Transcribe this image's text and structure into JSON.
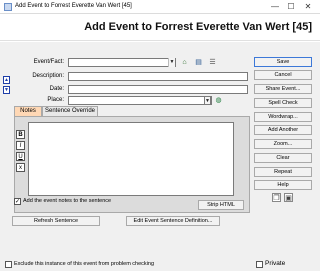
{
  "window": {
    "title": "Add Event to Forrest Everette Van Wert [45]",
    "heading": "Add Event to Forrest Everette Van Wert [45]",
    "minimize_glyph": "—",
    "maximize_glyph": "☐",
    "close_glyph": "✕"
  },
  "form": {
    "event_label": "Event/Fact:",
    "description_label": "Description:",
    "date_label": "Date:",
    "place_label": "Place:",
    "event_value": "",
    "description_value": "",
    "date_value": "",
    "place_value": ""
  },
  "tabs": [
    {
      "label": "Notes"
    },
    {
      "label": "Sentence Override"
    }
  ],
  "formatting": {
    "bold": "B",
    "italic": "I",
    "underline": "U",
    "remove": "x"
  },
  "notes": {
    "text": "",
    "add_to_sentence_label": "Add the event notes to the sentence",
    "add_to_sentence_checked": true,
    "strip_html_label": "Strip HTML"
  },
  "actions": {
    "refresh_sentence": "Refresh Sentence",
    "edit_sentence_definition": "Edit Event Sentence Definition..."
  },
  "side_buttons": {
    "save": "Save",
    "cancel": "Cancel",
    "share_event": "Share Event...",
    "spell_check": "Spell Check",
    "wordwrap": "Wordwrap...",
    "add_another": "Add Another",
    "zoom": "Zoom...",
    "clear": "Clear",
    "repeat": "Repeat",
    "help": "Help"
  },
  "footer": {
    "exclude_label": "Exclude this instance of this event from problem checking",
    "exclude_checked": false,
    "private_label": "Private",
    "private_checked": false
  },
  "icons": [
    "app-icon",
    "home-icon",
    "book-icon",
    "list-icon",
    "globe-icon",
    "up-arrow-icon",
    "down-arrow-icon",
    "copy-icon",
    "paste-icon"
  ],
  "colors": {
    "active_tab": "#ffd8b5",
    "primary_border": "#3c78d8",
    "nav_blue": "#1e3ea8"
  }
}
